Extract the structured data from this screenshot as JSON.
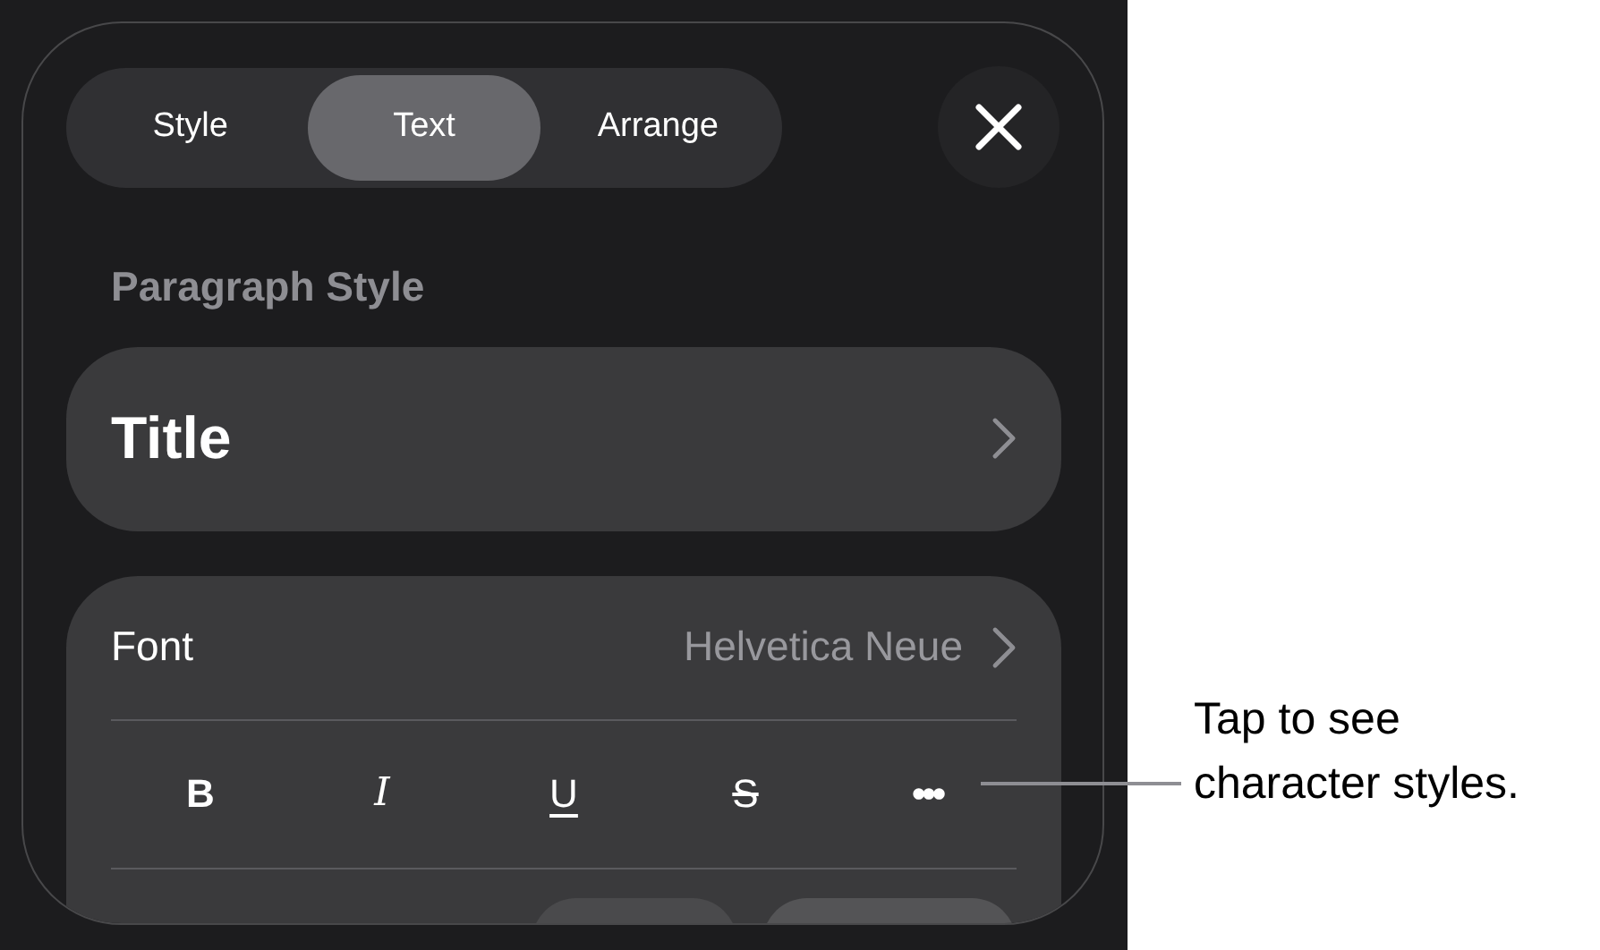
{
  "tabs": [
    {
      "label": "Style",
      "selected": false
    },
    {
      "label": "Text",
      "selected": true
    },
    {
      "label": "Arrange",
      "selected": false
    }
  ],
  "paragraph_style": {
    "heading": "Paragraph Style",
    "value": "Title"
  },
  "font": {
    "label": "Font",
    "value": "Helvetica Neue"
  },
  "format_buttons": [
    {
      "kind": "bold",
      "label": "B"
    },
    {
      "kind": "italic",
      "label": "I"
    },
    {
      "kind": "underline",
      "label": "U"
    },
    {
      "kind": "strike",
      "label": "S"
    },
    {
      "kind": "more",
      "label": "•••"
    }
  ],
  "callout": "Tap to see character styles."
}
